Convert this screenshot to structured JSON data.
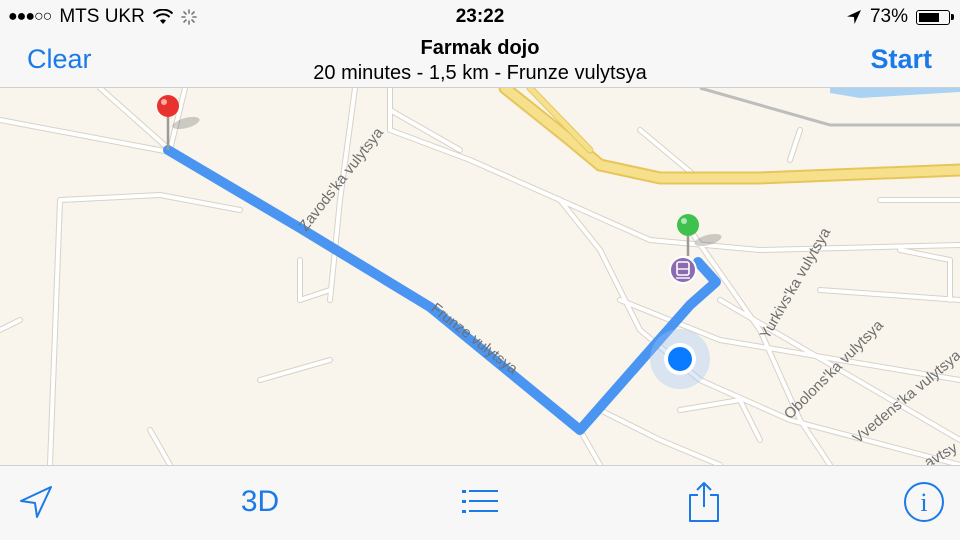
{
  "status": {
    "carrier": "MTS UKR",
    "time": "23:22",
    "battery_percent": "73%",
    "battery_level": 0.73,
    "signal_bars_filled": 3,
    "signal_bars_total": 5
  },
  "nav": {
    "left_label": "Clear",
    "right_label": "Start",
    "title": "Farmak dojo",
    "subtitle": "20 minutes - 1,5 km - Frunze vulytsya"
  },
  "map": {
    "streets": {
      "zavodska": "Zavods'ka vulytsya",
      "frunze": "Frunze vulytsya",
      "yurkivska": "Yurkivs'ka vulytsya",
      "obolonska": "Obolons'ka vulytsya",
      "vvedenska": "Vvedens'ka vulytsya",
      "vavtsy": "avtsy"
    },
    "colors": {
      "route": "#4a95f2",
      "destination_pin": "#e8322e",
      "start_pin": "#3fc24d",
      "user_location": "#0a7afe",
      "land": "#f9f5ed",
      "highway": "#f6dc7a",
      "water": "#a9d2f3"
    },
    "icons": {
      "destination": "red-pin-icon",
      "origin": "green-pin-icon",
      "transit": "train-station-icon",
      "location": "current-location-icon"
    }
  },
  "toolbar": {
    "three_d_label": "3D",
    "icons": [
      "location-arrow-icon",
      "3d-toggle",
      "list-icon",
      "share-icon",
      "info-icon"
    ]
  },
  "accent": "#1a7ae8"
}
